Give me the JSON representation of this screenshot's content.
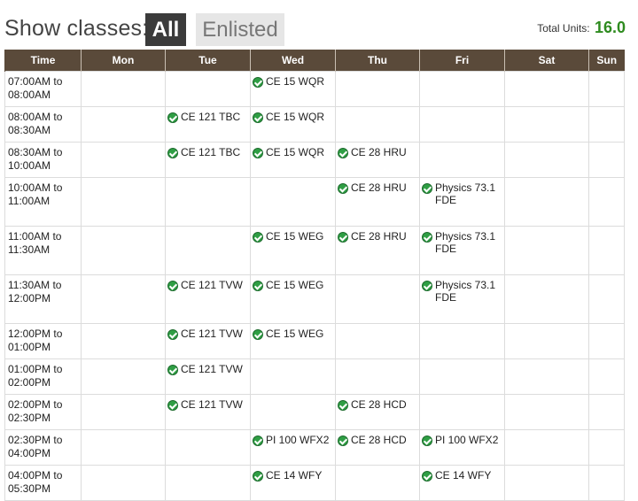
{
  "filter": {
    "label": "Show classes:",
    "all_label": "All",
    "enlisted_label": "Enlisted"
  },
  "total_units": {
    "label": "Total Units:",
    "value": "16.0"
  },
  "colors": {
    "header_bg": "#5a4a3a",
    "active_filter_bg": "#3b3b3b",
    "units_green": "#2e8b1f",
    "check_green": "#2f9e44"
  },
  "table": {
    "headers": [
      "Time",
      "Mon",
      "Tue",
      "Wed",
      "Thu",
      "Fri",
      "Sat",
      "Sun"
    ],
    "rows": [
      {
        "time": "07:00AM to 08:00AM",
        "cells": [
          "",
          "",
          "CE 15 WQR",
          "",
          "",
          "",
          ""
        ]
      },
      {
        "time": "08:00AM to 08:30AM",
        "cells": [
          "",
          "CE 121 TBC",
          "CE 15 WQR",
          "",
          "",
          "",
          ""
        ]
      },
      {
        "time": "08:30AM to 10:00AM",
        "cells": [
          "",
          "CE 121 TBC",
          "CE 15 WQR",
          "CE 28 HRU",
          "",
          "",
          ""
        ]
      },
      {
        "time": "10:00AM to 11:00AM",
        "cells": [
          "",
          "",
          "",
          "CE 28 HRU",
          "Physics 73.1 FDE",
          "",
          ""
        ]
      },
      {
        "time": "11:00AM to 11:30AM",
        "cells": [
          "",
          "",
          "CE 15 WEG",
          "CE 28 HRU",
          "Physics 73.1 FDE",
          "",
          ""
        ]
      },
      {
        "time": "11:30AM to 12:00PM",
        "cells": [
          "",
          "CE 121 TVW",
          "CE 15 WEG",
          "",
          "Physics 73.1 FDE",
          "",
          ""
        ]
      },
      {
        "time": "12:00PM to 01:00PM",
        "cells": [
          "",
          "CE 121 TVW",
          "CE 15 WEG",
          "",
          "",
          "",
          ""
        ]
      },
      {
        "time": "01:00PM to 02:00PM",
        "cells": [
          "",
          "CE 121 TVW",
          "",
          "",
          "",
          "",
          ""
        ]
      },
      {
        "time": "02:00PM to 02:30PM",
        "cells": [
          "",
          "CE 121 TVW",
          "",
          "CE 28 HCD",
          "",
          "",
          ""
        ]
      },
      {
        "time": "02:30PM to 04:00PM",
        "cells": [
          "",
          "",
          "PI 100 WFX2",
          "CE 28 HCD",
          "PI 100 WFX2",
          "",
          ""
        ]
      },
      {
        "time": "04:00PM to 05:30PM",
        "cells": [
          "",
          "",
          "CE 14 WFY",
          "",
          "CE 14 WFY",
          "",
          ""
        ]
      }
    ]
  }
}
